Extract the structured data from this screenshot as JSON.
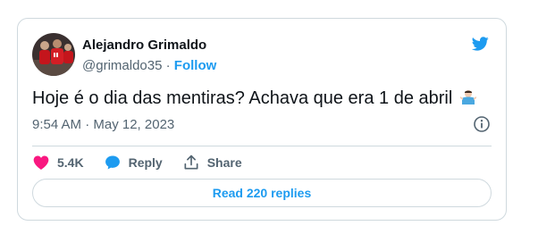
{
  "tweet": {
    "author_name": "Alejandro Grimaldo",
    "handle": "@grimaldo35",
    "separator": "·",
    "follow_label": "Follow",
    "text": "Hoje é o dia das mentiras? Achava que era 1 de abril",
    "emoji_icon": "man-shrugging-icon",
    "timestamp": "9:54 AM · May 12, 2023",
    "like_count": "5.4K",
    "reply_label": "Reply",
    "share_label": "Share",
    "read_replies_label": "Read 220 replies"
  },
  "colors": {
    "accent": "#1d9bf0",
    "like": "#f91880",
    "muted": "#536471",
    "border": "#cfd9de"
  }
}
